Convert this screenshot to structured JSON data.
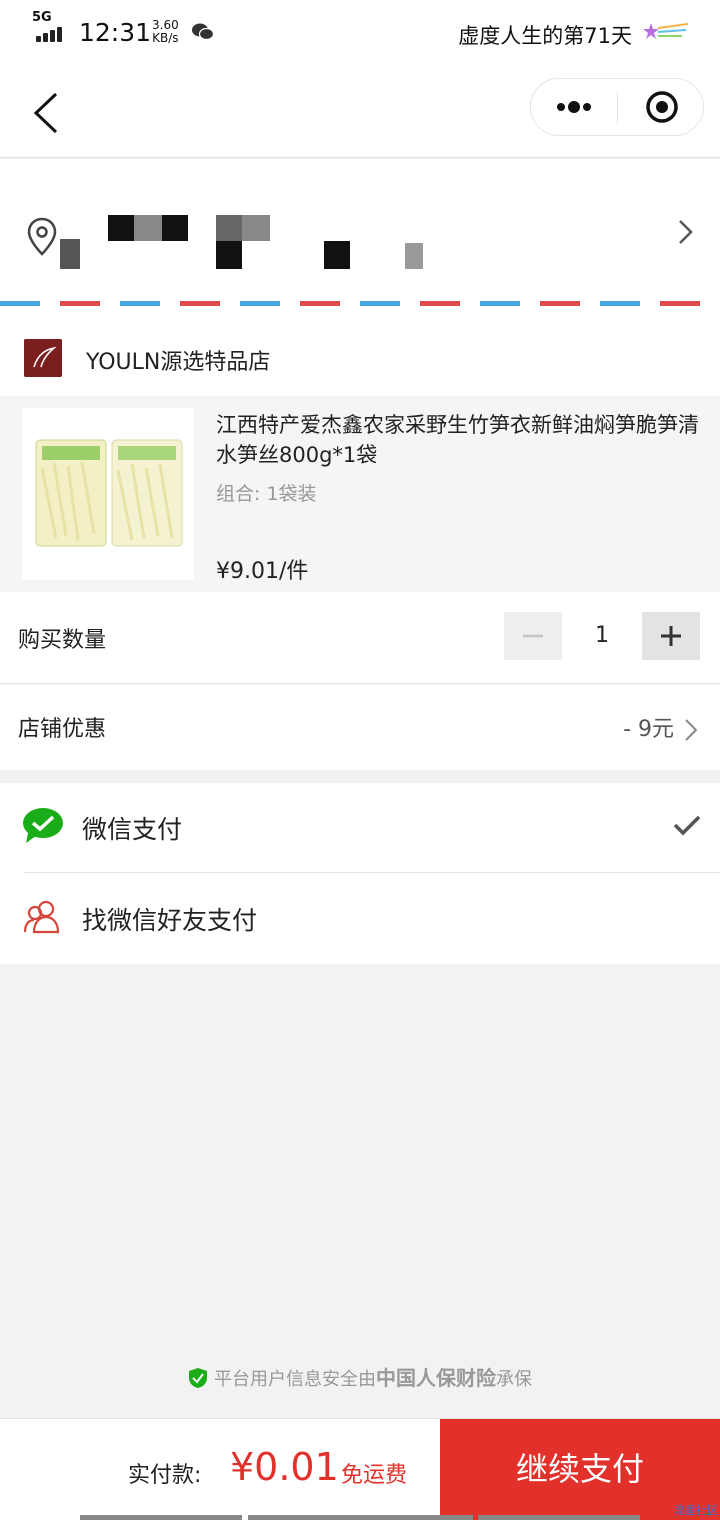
{
  "status_bar": {
    "network": "5G",
    "time": "12:31",
    "speed_value": "3.60",
    "speed_unit": "KB/s",
    "right_text": "虚度人生的第71天"
  },
  "nav": {
    "back_icon": "chevron-left-icon",
    "more_icon": "more-dots-icon",
    "close_icon": "target-close-icon"
  },
  "address": {
    "icon": "location-pin-icon",
    "masked": true
  },
  "shop": {
    "name": "YOULN源选特品店"
  },
  "product": {
    "title": "江西特产爱杰鑫农家采野生竹笋衣新鲜油焖笋脆笋清水笋丝800g*1袋",
    "spec": "组合: 1袋装",
    "price": "¥9.01/件"
  },
  "quantity": {
    "label": "购买数量",
    "minus": "−",
    "value": "1",
    "plus": "+"
  },
  "discount": {
    "label": "店铺优惠",
    "value": "- 9元"
  },
  "payment": {
    "options": [
      {
        "label": "微信支付",
        "icon": "wechat-pay-icon",
        "selected": true
      },
      {
        "label": "找微信好友支付",
        "icon": "friends-pay-icon",
        "selected": false
      }
    ]
  },
  "insurance": {
    "prefix": "平台用户信息安全由",
    "brand": "中国人保财险",
    "suffix": "承保"
  },
  "bottom": {
    "total_label": "实付款:",
    "total_amount": "¥0.01",
    "shipping": "免运费",
    "button": "继续支付",
    "watermark": "流星社区"
  },
  "colors": {
    "accent": "#e2312b",
    "wechat_green": "#1aad19",
    "background": "#f2f2f2"
  }
}
